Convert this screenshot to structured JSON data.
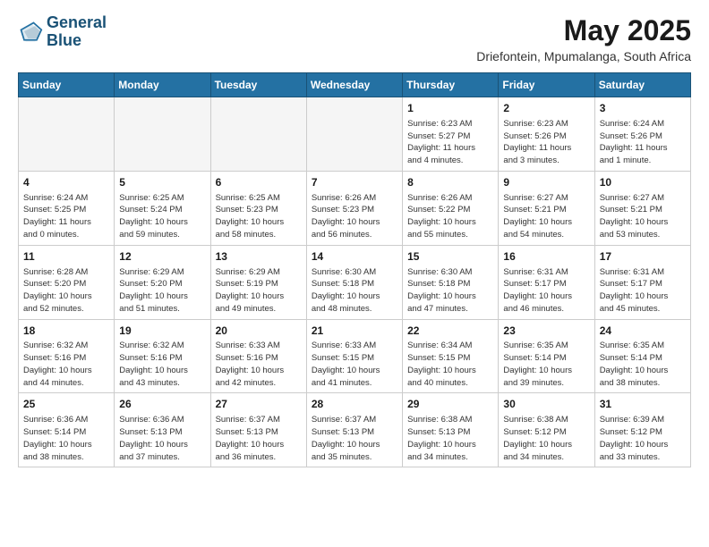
{
  "logo": {
    "line1": "General",
    "line2": "Blue"
  },
  "title": "May 2025",
  "location": "Driefontein, Mpumalanga, South Africa",
  "weekdays": [
    "Sunday",
    "Monday",
    "Tuesday",
    "Wednesday",
    "Thursday",
    "Friday",
    "Saturday"
  ],
  "weeks": [
    [
      {
        "day": "",
        "info": ""
      },
      {
        "day": "",
        "info": ""
      },
      {
        "day": "",
        "info": ""
      },
      {
        "day": "",
        "info": ""
      },
      {
        "day": "1",
        "info": "Sunrise: 6:23 AM\nSunset: 5:27 PM\nDaylight: 11 hours\nand 4 minutes."
      },
      {
        "day": "2",
        "info": "Sunrise: 6:23 AM\nSunset: 5:26 PM\nDaylight: 11 hours\nand 3 minutes."
      },
      {
        "day": "3",
        "info": "Sunrise: 6:24 AM\nSunset: 5:26 PM\nDaylight: 11 hours\nand 1 minute."
      }
    ],
    [
      {
        "day": "4",
        "info": "Sunrise: 6:24 AM\nSunset: 5:25 PM\nDaylight: 11 hours\nand 0 minutes."
      },
      {
        "day": "5",
        "info": "Sunrise: 6:25 AM\nSunset: 5:24 PM\nDaylight: 10 hours\nand 59 minutes."
      },
      {
        "day": "6",
        "info": "Sunrise: 6:25 AM\nSunset: 5:23 PM\nDaylight: 10 hours\nand 58 minutes."
      },
      {
        "day": "7",
        "info": "Sunrise: 6:26 AM\nSunset: 5:23 PM\nDaylight: 10 hours\nand 56 minutes."
      },
      {
        "day": "8",
        "info": "Sunrise: 6:26 AM\nSunset: 5:22 PM\nDaylight: 10 hours\nand 55 minutes."
      },
      {
        "day": "9",
        "info": "Sunrise: 6:27 AM\nSunset: 5:21 PM\nDaylight: 10 hours\nand 54 minutes."
      },
      {
        "day": "10",
        "info": "Sunrise: 6:27 AM\nSunset: 5:21 PM\nDaylight: 10 hours\nand 53 minutes."
      }
    ],
    [
      {
        "day": "11",
        "info": "Sunrise: 6:28 AM\nSunset: 5:20 PM\nDaylight: 10 hours\nand 52 minutes."
      },
      {
        "day": "12",
        "info": "Sunrise: 6:29 AM\nSunset: 5:20 PM\nDaylight: 10 hours\nand 51 minutes."
      },
      {
        "day": "13",
        "info": "Sunrise: 6:29 AM\nSunset: 5:19 PM\nDaylight: 10 hours\nand 49 minutes."
      },
      {
        "day": "14",
        "info": "Sunrise: 6:30 AM\nSunset: 5:18 PM\nDaylight: 10 hours\nand 48 minutes."
      },
      {
        "day": "15",
        "info": "Sunrise: 6:30 AM\nSunset: 5:18 PM\nDaylight: 10 hours\nand 47 minutes."
      },
      {
        "day": "16",
        "info": "Sunrise: 6:31 AM\nSunset: 5:17 PM\nDaylight: 10 hours\nand 46 minutes."
      },
      {
        "day": "17",
        "info": "Sunrise: 6:31 AM\nSunset: 5:17 PM\nDaylight: 10 hours\nand 45 minutes."
      }
    ],
    [
      {
        "day": "18",
        "info": "Sunrise: 6:32 AM\nSunset: 5:16 PM\nDaylight: 10 hours\nand 44 minutes."
      },
      {
        "day": "19",
        "info": "Sunrise: 6:32 AM\nSunset: 5:16 PM\nDaylight: 10 hours\nand 43 minutes."
      },
      {
        "day": "20",
        "info": "Sunrise: 6:33 AM\nSunset: 5:16 PM\nDaylight: 10 hours\nand 42 minutes."
      },
      {
        "day": "21",
        "info": "Sunrise: 6:33 AM\nSunset: 5:15 PM\nDaylight: 10 hours\nand 41 minutes."
      },
      {
        "day": "22",
        "info": "Sunrise: 6:34 AM\nSunset: 5:15 PM\nDaylight: 10 hours\nand 40 minutes."
      },
      {
        "day": "23",
        "info": "Sunrise: 6:35 AM\nSunset: 5:14 PM\nDaylight: 10 hours\nand 39 minutes."
      },
      {
        "day": "24",
        "info": "Sunrise: 6:35 AM\nSunset: 5:14 PM\nDaylight: 10 hours\nand 38 minutes."
      }
    ],
    [
      {
        "day": "25",
        "info": "Sunrise: 6:36 AM\nSunset: 5:14 PM\nDaylight: 10 hours\nand 38 minutes."
      },
      {
        "day": "26",
        "info": "Sunrise: 6:36 AM\nSunset: 5:13 PM\nDaylight: 10 hours\nand 37 minutes."
      },
      {
        "day": "27",
        "info": "Sunrise: 6:37 AM\nSunset: 5:13 PM\nDaylight: 10 hours\nand 36 minutes."
      },
      {
        "day": "28",
        "info": "Sunrise: 6:37 AM\nSunset: 5:13 PM\nDaylight: 10 hours\nand 35 minutes."
      },
      {
        "day": "29",
        "info": "Sunrise: 6:38 AM\nSunset: 5:13 PM\nDaylight: 10 hours\nand 34 minutes."
      },
      {
        "day": "30",
        "info": "Sunrise: 6:38 AM\nSunset: 5:12 PM\nDaylight: 10 hours\nand 34 minutes."
      },
      {
        "day": "31",
        "info": "Sunrise: 6:39 AM\nSunset: 5:12 PM\nDaylight: 10 hours\nand 33 minutes."
      }
    ]
  ]
}
